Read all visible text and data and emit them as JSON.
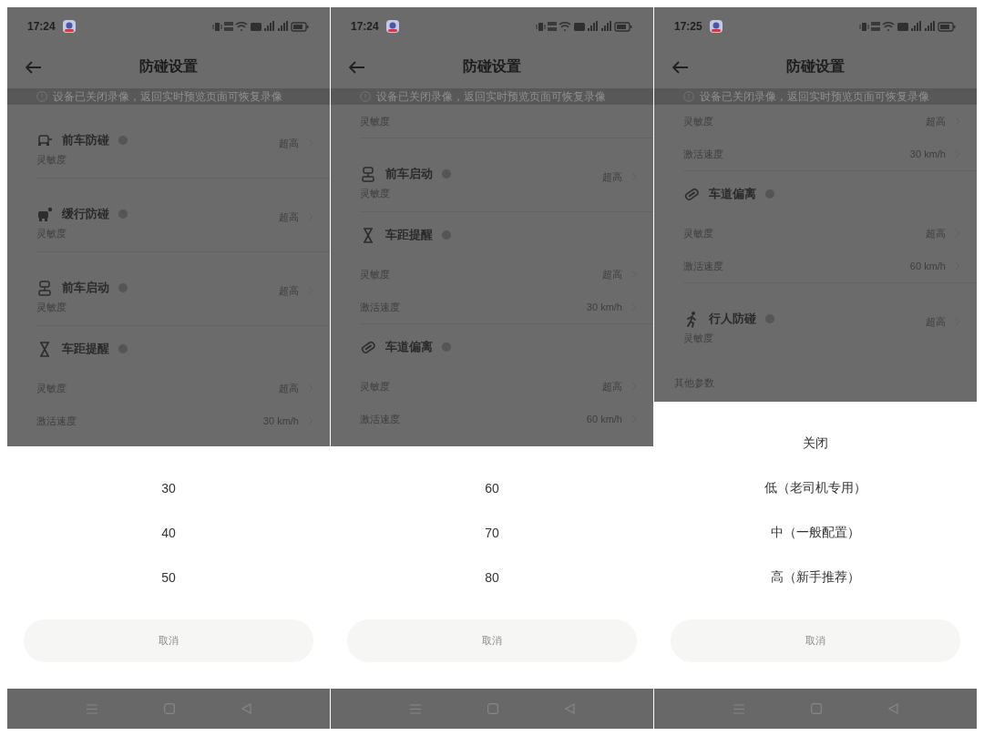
{
  "phones": [
    {
      "status_bar": {
        "time": "17:24"
      },
      "header": {
        "title": "防碰设置"
      },
      "banner": {
        "text": "设备已关闭录像，返回实时预览页面可恢复录像"
      },
      "items": [
        {
          "kind": "feature_row",
          "name": "前车防碰",
          "label": "灵敏度",
          "value": "超高"
        },
        {
          "kind": "feature_row",
          "name": "缓行防碰",
          "label": "灵敏度",
          "value": "超高"
        },
        {
          "kind": "feature_row",
          "name": "前车启动",
          "label": "灵敏度",
          "value": "超高"
        },
        {
          "kind": "feature",
          "name": "车距提醒"
        },
        {
          "kind": "row",
          "label": "灵敏度",
          "value": "超高"
        },
        {
          "kind": "row",
          "label": "激活速度",
          "value": "30 km/h"
        }
      ],
      "sheet": {
        "options": [
          "30",
          "40",
          "50"
        ],
        "cancel": "取消"
      }
    },
    {
      "status_bar": {
        "time": "17:24"
      },
      "header": {
        "title": "防碰设置"
      },
      "banner": {
        "text": "设备已关闭录像，返回实时预览页面可恢复录像"
      },
      "items": [
        {
          "kind": "row",
          "label": "灵敏度"
        },
        {
          "kind": "feature_row",
          "name": "前车启动",
          "label": "灵敏度",
          "value": "超高"
        },
        {
          "kind": "feature",
          "name": "车距提醒"
        },
        {
          "kind": "row",
          "label": "灵敏度",
          "value": "超高"
        },
        {
          "kind": "row",
          "label": "激活速度",
          "value": "30 km/h"
        },
        {
          "kind": "feature",
          "name": "车道偏离"
        },
        {
          "kind": "row",
          "label": "灵敏度",
          "value": "超高"
        },
        {
          "kind": "row",
          "label": "激活速度",
          "value": "60 km/h"
        }
      ],
      "sheet": {
        "options": [
          "60",
          "70",
          "80"
        ],
        "cancel": "取消"
      }
    },
    {
      "status_bar": {
        "time": "17:25"
      },
      "header": {
        "title": "防碰设置"
      },
      "banner": {
        "text": "设备已关闭录像，返回实时预览页面可恢复录像"
      },
      "items": [
        {
          "kind": "row",
          "label": "灵敏度",
          "value": "超高"
        },
        {
          "kind": "row",
          "label": "激活速度",
          "value": "30 km/h"
        },
        {
          "kind": "feature",
          "name": "车道偏离"
        },
        {
          "kind": "row",
          "label": "灵敏度",
          "value": "超高"
        },
        {
          "kind": "row",
          "label": "激活速度",
          "value": "60 km/h"
        },
        {
          "kind": "feature_row",
          "name": "行人防碰",
          "label": "灵敏度",
          "value": "超高"
        },
        {
          "kind": "section",
          "label": "其他参数"
        }
      ],
      "sheet": {
        "options": [
          "关闭",
          "低（老司机专用）",
          "中（一般配置）",
          "高（新手推荐）"
        ],
        "cancel": "取消"
      }
    }
  ]
}
